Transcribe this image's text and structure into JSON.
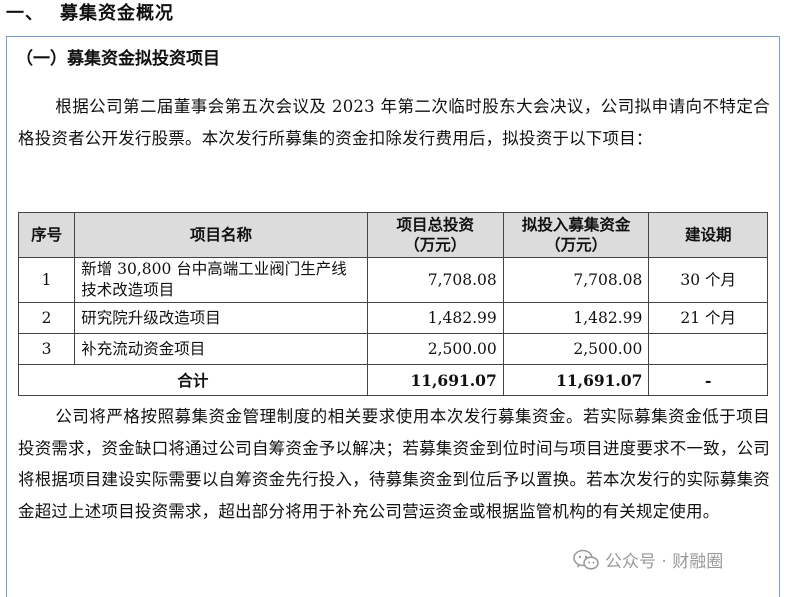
{
  "section": {
    "number": "一、",
    "title": "募集资金概况"
  },
  "subsection": {
    "title": "（一）募集资金拟投资项目"
  },
  "intro_paragraph": "根据公司第二届董事会第五次会议及 2023 年第二次临时股东大会决议，公司拟申请向不特定合格投资者公开发行股票。本次发行所募集的资金扣除发行费用后，拟投资于以下项目：",
  "table": {
    "headers": {
      "seq": "序号",
      "name": "项目名称",
      "total_invest_1": "项目总投资",
      "total_invest_2": "（万元）",
      "raised_1": "拟投入募集资金",
      "raised_2": "（万元）",
      "period": "建设期"
    },
    "rows": [
      {
        "seq": "1",
        "name": "新增 30,800 台中高端工业阀门生产线技术改造项目",
        "total": "7,708.08",
        "raised": "7,708.08",
        "period": "30 个月"
      },
      {
        "seq": "2",
        "name": "研究院升级改造项目",
        "total": "1,482.99",
        "raised": "1,482.99",
        "period": "21 个月"
      },
      {
        "seq": "3",
        "name": "补充流动资金项目",
        "total": "2,500.00",
        "raised": "2,500.00",
        "period": ""
      }
    ],
    "total_row": {
      "label": "合计",
      "total": "11,691.07",
      "raised": "11,691.07",
      "period": "-"
    }
  },
  "closing_paragraph": "公司将严格按照募集资金管理制度的相关要求使用本次发行募集资金。若实际募集资金低于项目投资需求，资金缺口将通过公司自筹资金予以解决；若募集资金到位时间与项目进度要求不一致，公司将根据项目建设实际需要以自筹资金先行投入，待募集资金到位后予以置换。若本次发行的实际募集资金超过上述项目投资需求，超出部分将用于补充公司营运资金或根据监管机构的有关规定使用。",
  "watermark": {
    "text": "公众号 · 财融圈",
    "icon": "wechat-icon"
  }
}
